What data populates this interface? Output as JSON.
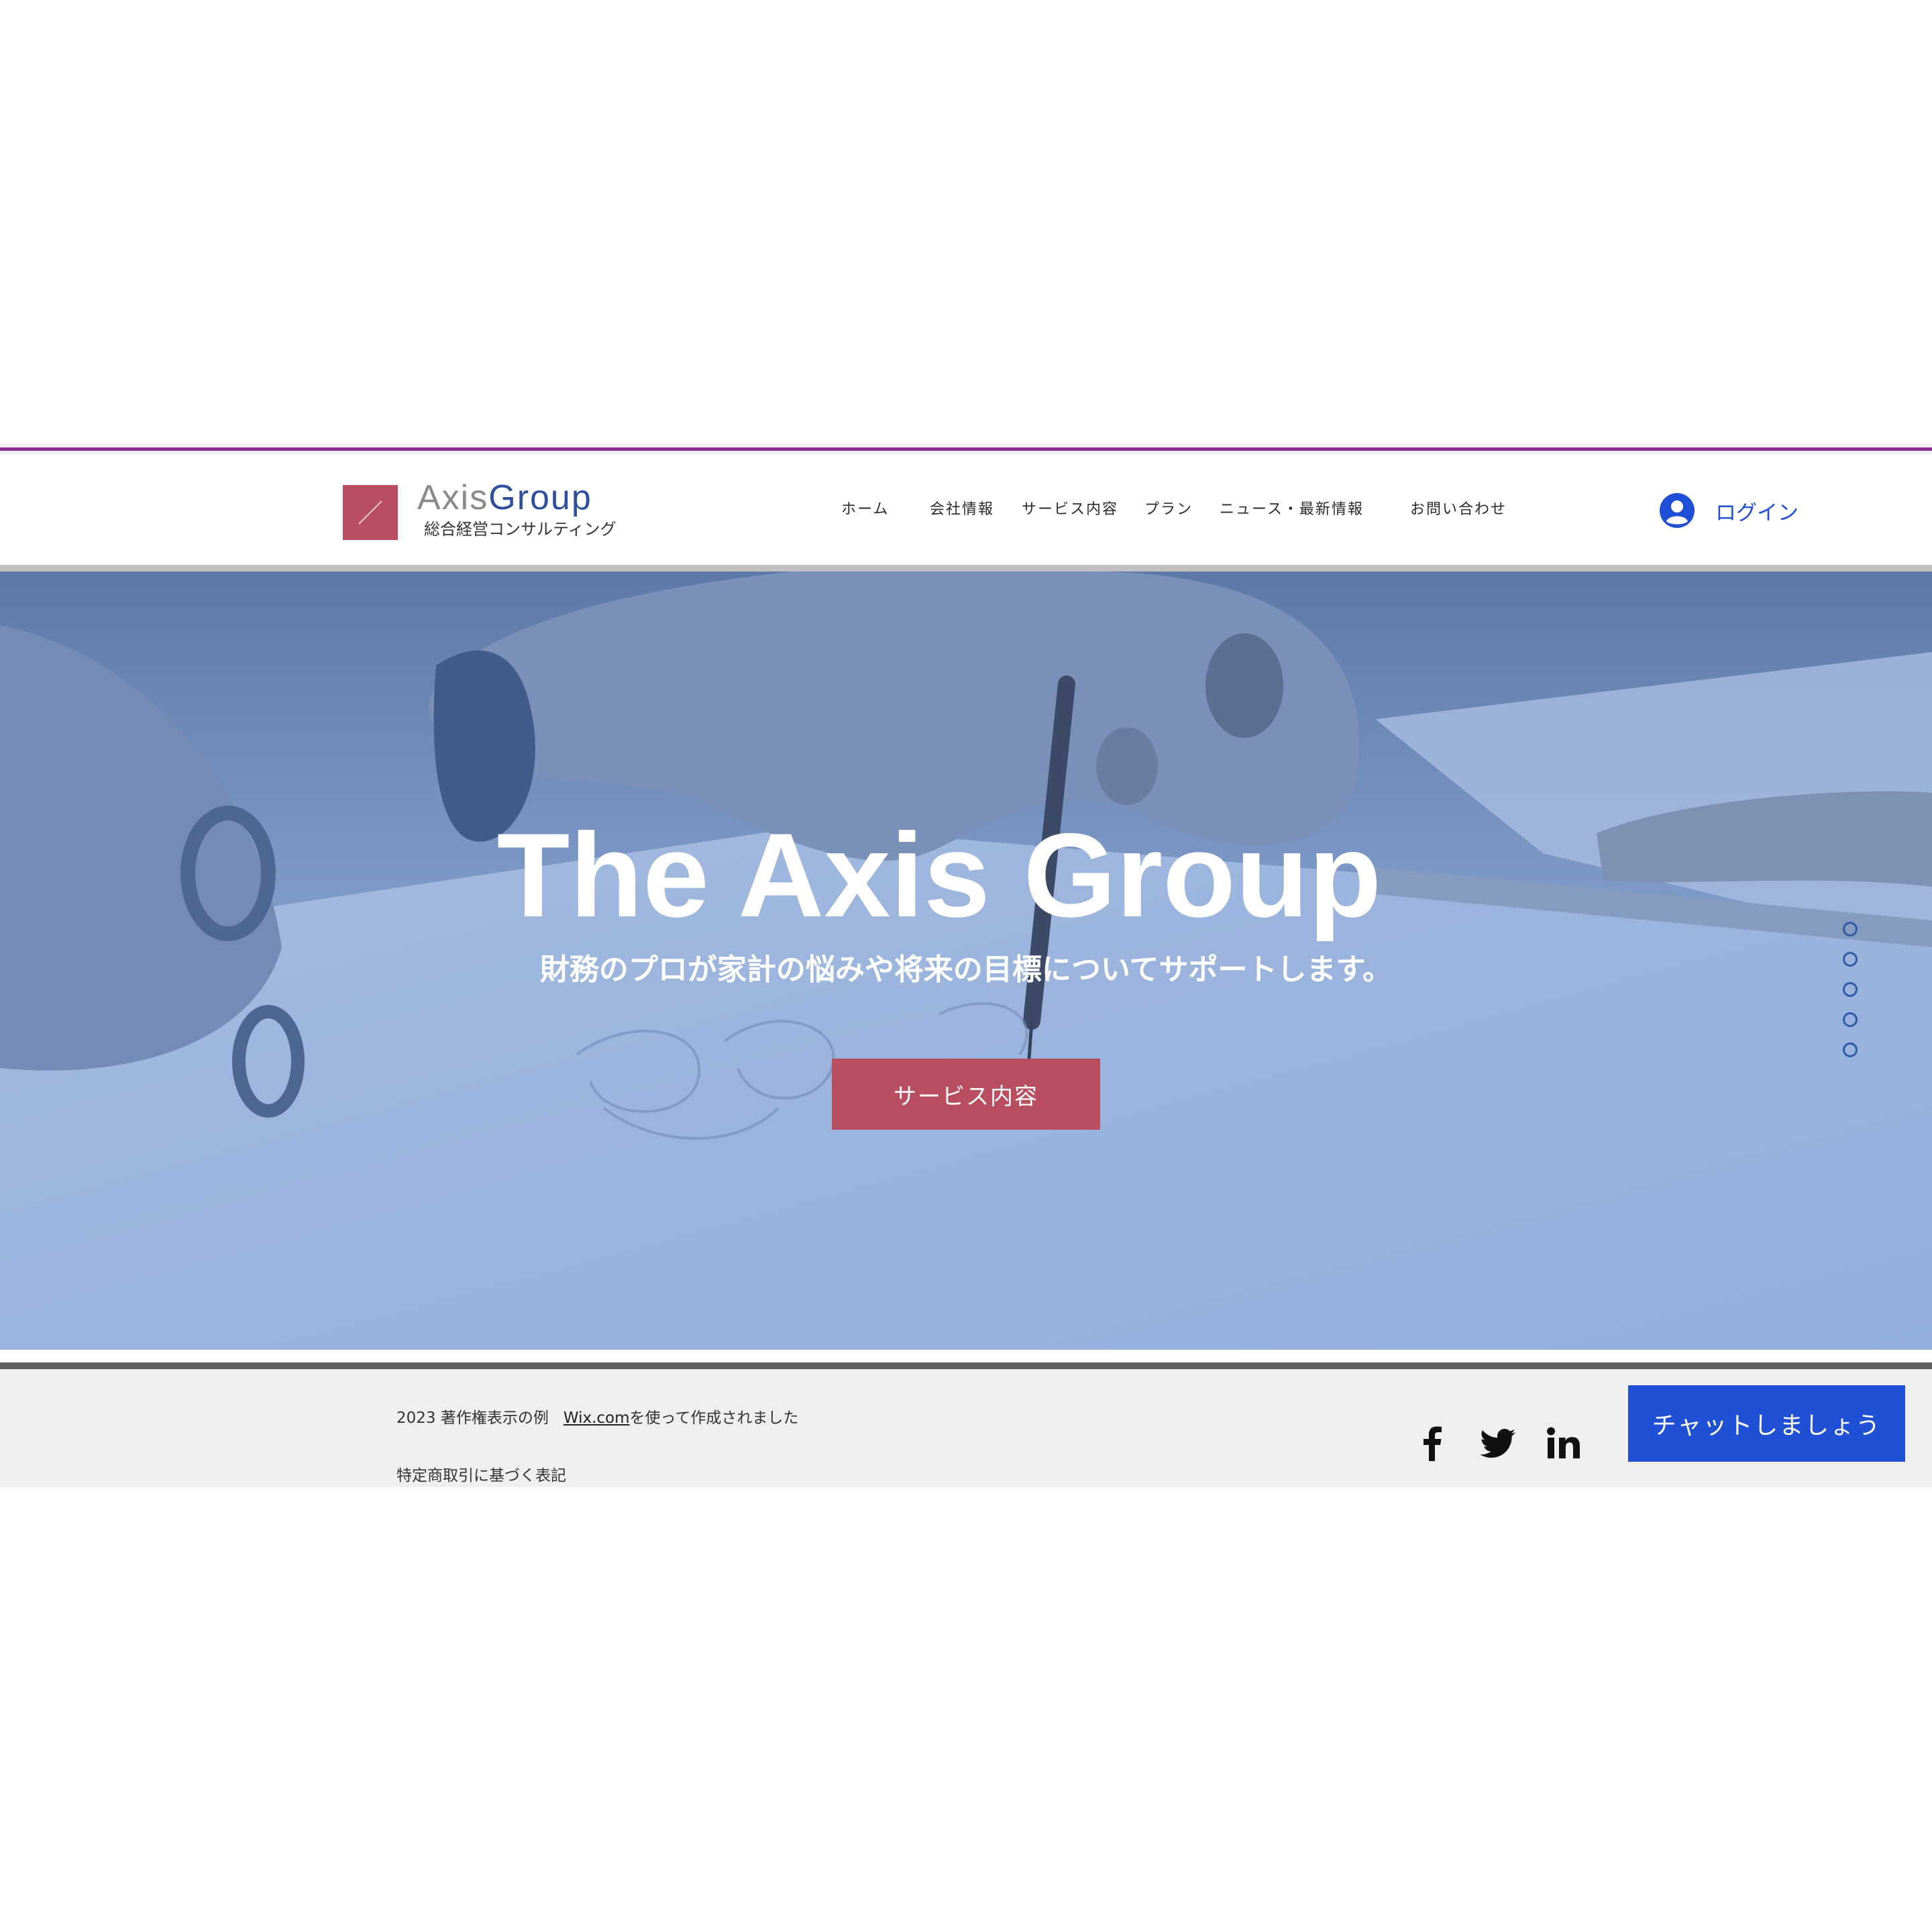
{
  "logo": {
    "name_part1": "Axis",
    "name_part2": "Group",
    "tagline": "総合経営コンサルティング"
  },
  "nav": {
    "items": [
      {
        "label": "ホーム"
      },
      {
        "label": "会社情報"
      },
      {
        "label": "サービス内容"
      },
      {
        "label": "プラン"
      },
      {
        "label": "ニュース・最新情報"
      },
      {
        "label": "お問い合わせ"
      }
    ]
  },
  "login": {
    "icon": "user-avatar-icon",
    "label": "ログイン"
  },
  "hero": {
    "title": "The Axis Group",
    "subtitle": "財務のプロが家計の悩みや将来の目標についてサポートします。",
    "button_label": "サービス内容",
    "slide_count": 5
  },
  "footer": {
    "copyright_prefix": "2023 著作権表示の例",
    "copyright_link": "Wix.com",
    "copyright_suffix": "を使って作成されました",
    "legal_link": "特定商取引に基づく表記",
    "social": [
      {
        "icon": "facebook-icon"
      },
      {
        "icon": "twitter-icon"
      },
      {
        "icon": "linkedin-icon"
      }
    ]
  },
  "chat": {
    "label": "チャットしましょう"
  },
  "colors": {
    "brand_red": "#b84e60",
    "brand_blue": "#2f4e9e",
    "accent_purple": "#8e2d92",
    "link_blue": "#1f4fd6",
    "chat_blue": "#1f50d6",
    "hero_overlay": "#7f9dc7"
  }
}
